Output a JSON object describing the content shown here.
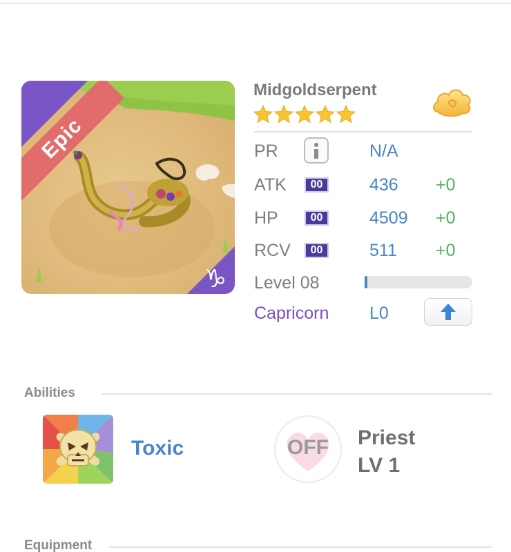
{
  "card": {
    "rarity_label": "Epic",
    "zodiac_symbol": "♑",
    "rarity_color": "#e26b6b",
    "frame_color": "#7a55c5"
  },
  "pet": {
    "name": "Midgoldserpent",
    "star_count": 5,
    "element_icon": "cloud-icon"
  },
  "stats": {
    "pr": {
      "label": "PR",
      "value": "N/A"
    },
    "atk": {
      "label": "ATK",
      "badge": "00",
      "value": "436",
      "bonus": "+0"
    },
    "hp": {
      "label": "HP",
      "badge": "00",
      "value": "4509",
      "bonus": "+0"
    },
    "rcv": {
      "label": "RCV",
      "badge": "00",
      "value": "511",
      "bonus": "+0"
    },
    "level": {
      "label": "Level 08",
      "progress_fraction": 0.02
    },
    "zodiac": {
      "label": "Capricorn",
      "value": "L0"
    }
  },
  "abilities": {
    "title": "Abilities",
    "primary": {
      "name": "Toxic",
      "icon": "skull-icon"
    },
    "secondary": {
      "status": "OFF",
      "name": "Priest",
      "level": "LV 1",
      "icon": "heart-icon"
    }
  },
  "equipment": {
    "title": "Equipment"
  },
  "colors": {
    "value_blue": "#4a86c8",
    "bonus_green": "#52b05a",
    "zodiac_purple": "#7c4ec2",
    "badge_purple": "#4b3a9c"
  }
}
